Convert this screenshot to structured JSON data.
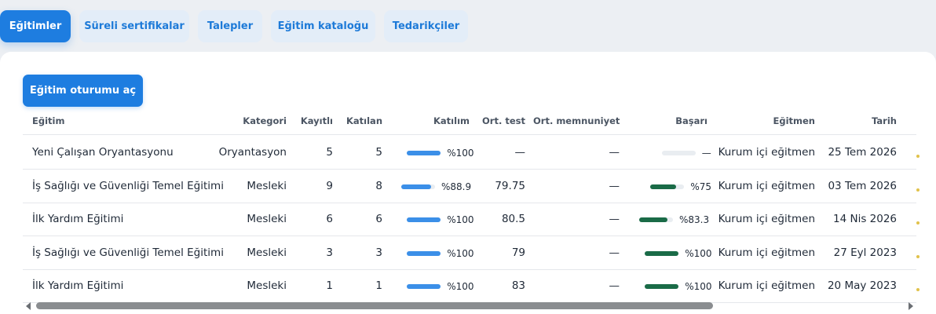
{
  "tabs": [
    {
      "label": "Eğitimler",
      "active": true
    },
    {
      "label": "Süreli sertifikalar",
      "active": false
    },
    {
      "label": "Talepler",
      "active": false
    },
    {
      "label": "Eğitim kataloğu",
      "active": false
    },
    {
      "label": "Tedarikçiler",
      "active": false
    }
  ],
  "actions": {
    "open_session": "Eğitim oturumu aç"
  },
  "table": {
    "columns": [
      "Eğitim",
      "Kategori",
      "Kayıtlı",
      "Katılan",
      "Katılım",
      "Ort. test",
      "Ort. memnuniyet",
      "Başarı",
      "Eğitmen",
      "Tarih"
    ],
    "rows": [
      {
        "training": "Yeni Çalışan Oryantasyonu",
        "category": "Oryantasyon",
        "registered": "5",
        "attended": "5",
        "participation": 1.0,
        "participation_label": "%100",
        "avg_test": "—",
        "avg_satisfaction": "—",
        "success": 0,
        "success_label": "—",
        "trainer": "Kurum içi eğitmen",
        "date": "25 Tem 2026"
      },
      {
        "training": "İş Sağlığı ve Güvenliği Temel Eğitimi",
        "category": "Mesleki",
        "registered": "9",
        "attended": "8",
        "participation": 0.889,
        "participation_label": "%88.9",
        "avg_test": "79.75",
        "avg_satisfaction": "—",
        "success": 0.75,
        "success_label": "%75",
        "trainer": "Kurum içi eğitmen",
        "date": "03 Tem 2026"
      },
      {
        "training": "İlk Yardım Eğitimi",
        "category": "Mesleki",
        "registered": "6",
        "attended": "6",
        "participation": 1.0,
        "participation_label": "%100",
        "avg_test": "80.5",
        "avg_satisfaction": "—",
        "success": 0.833,
        "success_label": "%83.3",
        "trainer": "Kurum içi eğitmen",
        "date": "14 Nis 2026"
      },
      {
        "training": "İş Sağlığı ve Güvenliği Temel Eğitimi",
        "category": "Mesleki",
        "registered": "3",
        "attended": "3",
        "participation": 1.0,
        "participation_label": "%100",
        "avg_test": "79",
        "avg_satisfaction": "—",
        "success": 1.0,
        "success_label": "%100",
        "trainer": "Kurum içi eğitmen",
        "date": "27 Eyl 2023"
      },
      {
        "training": "İlk Yardım Eğitimi",
        "category": "Mesleki",
        "registered": "1",
        "attended": "1",
        "participation": 1.0,
        "participation_label": "%100",
        "avg_test": "83",
        "avg_satisfaction": "—",
        "success": 1.0,
        "success_label": "%100",
        "trainer": "Kurum içi eğitmen",
        "date": "20 May 2023"
      }
    ]
  },
  "colors": {
    "accent": "#1e7de0",
    "participation_bar": "#3b8fe8",
    "success_bar": "#1a6b47"
  }
}
